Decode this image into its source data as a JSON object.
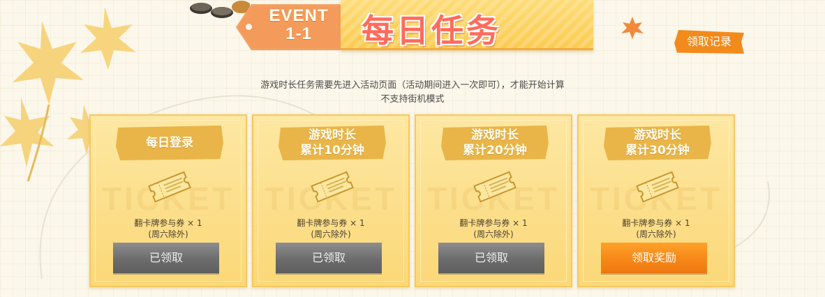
{
  "banner": {
    "tag_line1": "EVENT",
    "tag_line2": "1-1",
    "title": "每日任务"
  },
  "history_button": "领取记录",
  "notice": {
    "line1": "游戏时长任务需要先进入活动页面（活动期间进入一次即可），才能开始计算",
    "line2": "不支持街机模式"
  },
  "watermark": "TICKET",
  "tasks": [
    {
      "label": "每日登录",
      "reward": "翻卡牌参与券 × 1",
      "note": "(周六除外)",
      "button": "已领取",
      "state": "claimed"
    },
    {
      "label": "游戏时长\n累计10分钟",
      "reward": "翻卡牌参与券 × 1",
      "note": "(周六除外)",
      "button": "已领取",
      "state": "claimed"
    },
    {
      "label": "游戏时长\n累计20分钟",
      "reward": "翻卡牌参与券 × 1",
      "note": "(周六除外)",
      "button": "已领取",
      "state": "claimed"
    },
    {
      "label": "游戏时长\n累计30分钟",
      "reward": "翻卡牌参与券 × 1",
      "note": "(周六除外)",
      "button": "领取奖励",
      "state": "available"
    }
  ],
  "colors": {
    "accent_orange": "#f28a1c",
    "claimed_gray": "#6c6c6c",
    "card_gold": "#fbd878",
    "title_red": "#ff6b5c"
  },
  "icons": [
    "maple-leaf-icon",
    "ticket-icon",
    "coin-icon"
  ]
}
